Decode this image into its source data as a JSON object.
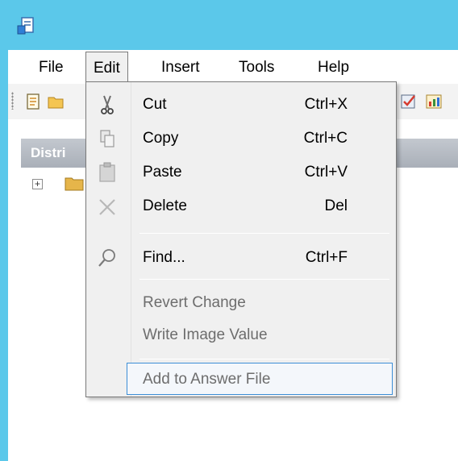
{
  "window": {
    "icon": "app-icon"
  },
  "menubar": {
    "items": [
      "File",
      "Edit",
      "Insert",
      "Tools",
      "Help"
    ],
    "active": "Edit"
  },
  "toolbar": {
    "icons": [
      "new-icon",
      "open-icon",
      "validate-icon",
      "chart-icon"
    ]
  },
  "panel": {
    "header_visible": "Distri"
  },
  "edit_menu": {
    "items": [
      {
        "label": "Cut",
        "shortcut": "Ctrl+X",
        "icon": "scissors-icon",
        "enabled": true
      },
      {
        "label": "Copy",
        "shortcut": "Ctrl+C",
        "icon": "copy-icon",
        "enabled": true
      },
      {
        "label": "Paste",
        "shortcut": "Ctrl+V",
        "icon": "paste-icon",
        "enabled": true
      },
      {
        "label": "Delete",
        "shortcut": "Del",
        "icon": "delete-icon",
        "enabled": true
      },
      {
        "label": "Find...",
        "shortcut": "Ctrl+F",
        "icon": "find-icon",
        "enabled": true
      },
      {
        "label": "Revert Change",
        "shortcut": "",
        "icon": "",
        "enabled": false
      },
      {
        "label": "Write Image Value",
        "shortcut": "",
        "icon": "",
        "enabled": false
      },
      {
        "label": "Add to Answer File",
        "shortcut": "",
        "icon": "",
        "enabled": false
      }
    ]
  },
  "colors": {
    "titlebar": "#5bc8ea",
    "menu_bg": "#f0f0f0",
    "focus_border": "#3c8ed6"
  }
}
